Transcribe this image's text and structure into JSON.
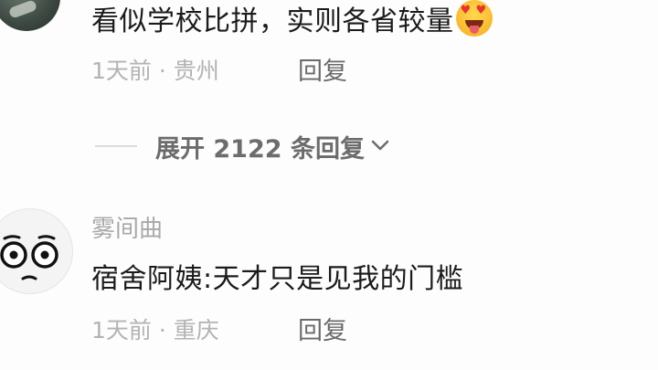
{
  "comments": [
    {
      "text": "看似学校比拼，实则各省较量",
      "emoji": "heart-eyes-tongue-emoji",
      "time": "1天前",
      "separator": "·",
      "location": "贵州",
      "reply_label": "回复"
    },
    {
      "username": "雾间曲",
      "text": "宿舍阿姨:天才只是见我的门槛",
      "time": "1天前",
      "separator": "·",
      "location": "重庆",
      "reply_label": "回复"
    }
  ],
  "expand_replies": {
    "label": "展开 2122 条回复",
    "icon": "chevron-down-icon"
  },
  "colors": {
    "primary_text": "#1b1b1b",
    "meta_text": "#b3b3b3",
    "reply_text": "#6a6a6a",
    "background": "#fdfdfd"
  }
}
